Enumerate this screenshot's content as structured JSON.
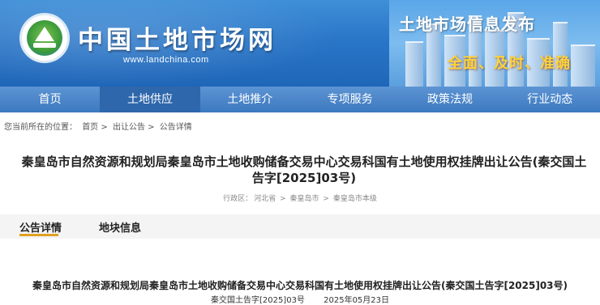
{
  "header": {
    "site_title": "中国土地市场网",
    "site_url": "www.landchina.com",
    "banner_title": "土地市场信息发布",
    "banner_slogan": "全面、及时、准确"
  },
  "nav": {
    "items": [
      {
        "label": "首页"
      },
      {
        "label": "土地供应"
      },
      {
        "label": "土地推介"
      },
      {
        "label": "专项服务"
      },
      {
        "label": "政策法规"
      },
      {
        "label": "行业动态"
      }
    ],
    "active_index": 1
  },
  "breadcrumb": {
    "prefix": "您当前所在的位置：",
    "items": [
      "首页",
      "出让公告",
      "公告详情"
    ],
    "separator": ">"
  },
  "announcement": {
    "title": "秦皇岛市自然资源和规划局秦皇岛市土地收购储备交易中心交易科国有土地使用权挂牌出让公告(秦交国土告字[2025]03号)",
    "region_label": "行政区：",
    "region_path": [
      "河北省",
      "秦皇岛市",
      "秦皇岛市本级"
    ]
  },
  "tabs": [
    {
      "label": "公告详情",
      "active": true
    },
    {
      "label": "地块信息",
      "active": false
    }
  ],
  "content": {
    "title": "秦皇岛市自然资源和规划局秦皇岛市土地收购储备交易中心交易科国有土地使用权挂牌出让公告(秦交国土告字[2025]03号)",
    "doc_number": "秦交国土告字[2025]03号",
    "date": "2025年05月23日"
  },
  "colors": {
    "header_blue": "#2a76c8",
    "nav_blue": "#3d79c0",
    "tab_accent": "#e0a020",
    "slogan_yellow": "#ffd23a"
  }
}
